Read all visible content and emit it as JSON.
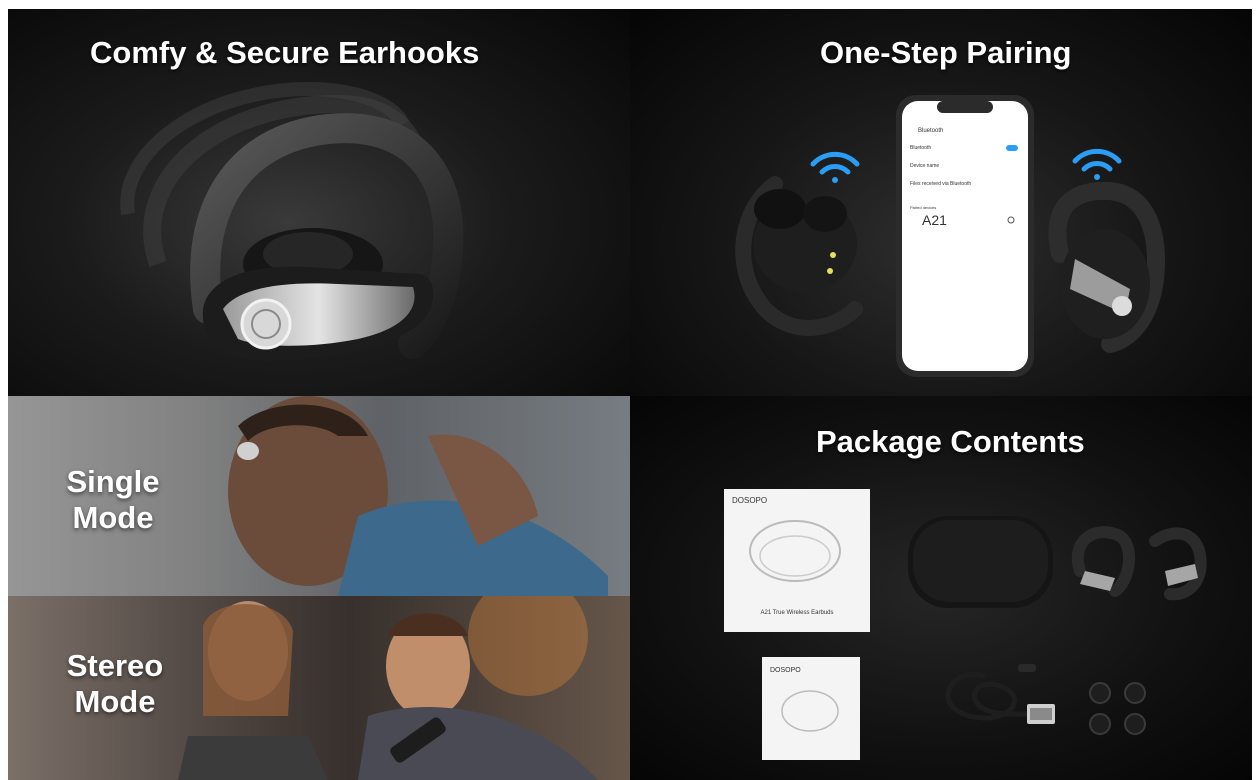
{
  "panels": {
    "earhooks": {
      "title": "Comfy & Secure Earhooks"
    },
    "pairing": {
      "title": "One-Step Pairing",
      "phone_screen": {
        "header": "Bluetooth",
        "rows": [
          "Bluetooth",
          "Device name",
          "Files received via Bluetooth"
        ],
        "section_label": "Paired devices",
        "paired_device": "A21"
      }
    },
    "single_mode": {
      "title_line1": "Single",
      "title_line2": "Mode"
    },
    "stereo_mode": {
      "title_line1": "Stereo",
      "title_line2": "Mode"
    },
    "package": {
      "title": "Package Contents",
      "box_brand": "DOSOPO",
      "box_caption": "A21 True Wireless Earbuds",
      "manual_brand": "DOSOPO"
    }
  },
  "colors": {
    "background": "#0d0d0d",
    "wifi_signal": "#2a9df4",
    "heading_text": "#ffffff"
  }
}
